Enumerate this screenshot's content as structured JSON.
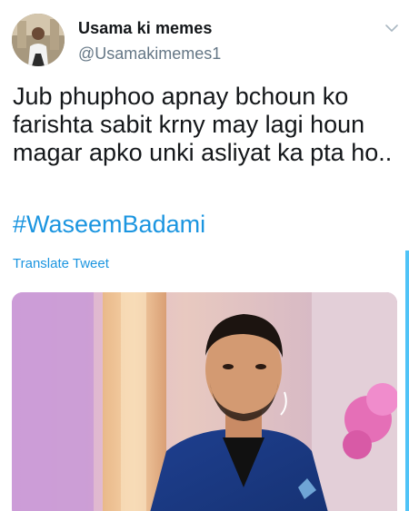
{
  "author": {
    "display_name": "Usama ki memes",
    "handle": "@Usamakimemes1",
    "avatar_icon": "profile-photo"
  },
  "tweet": {
    "text": "Jub phuphoo apnay bchoun ko farishta sabit krny may lagi houn magar apko unki asliyat ka pta ho..",
    "hashtag": "#WaseemBadami",
    "translate_label": "Translate Tweet"
  },
  "media": {
    "alt_icon": "photo-of-man-in-blue-suit"
  },
  "colors": {
    "link": "#1b95e0",
    "text": "#14171a",
    "muted": "#657786"
  }
}
